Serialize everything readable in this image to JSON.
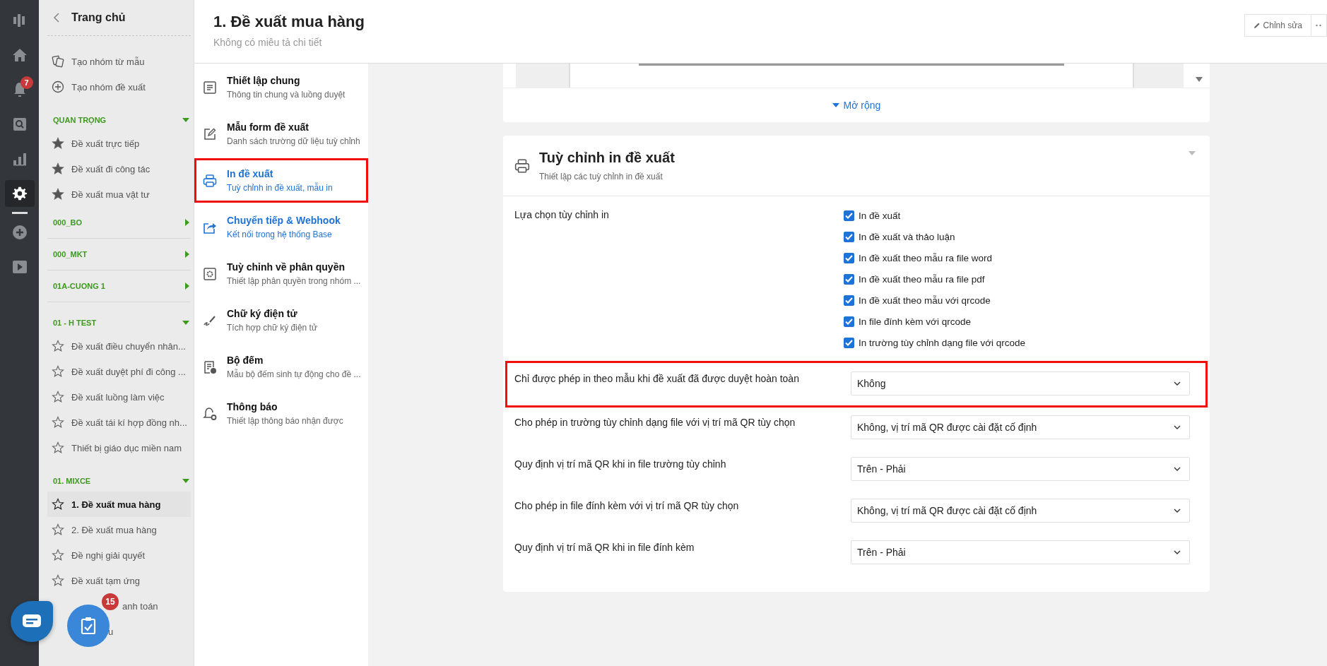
{
  "rail": [
    {
      "kind": "logo",
      "selected": false
    },
    {
      "kind": "home",
      "selected": false
    },
    {
      "kind": "bell",
      "selected": false,
      "badge": "7"
    },
    {
      "kind": "search",
      "selected": false
    },
    {
      "kind": "chart",
      "selected": false
    },
    {
      "kind": "gear",
      "selected": true
    },
    {
      "kind": "plus",
      "selected": false
    },
    {
      "kind": "play",
      "selected": false
    }
  ],
  "sidebar": {
    "title": "Trang chủ",
    "actions": [
      {
        "kind": "template",
        "label": "Tạo nhóm từ mẫu"
      },
      {
        "kind": "add",
        "label": "Tạo nhóm đề xuất"
      }
    ],
    "groups": [
      {
        "name": "QUAN TRỌNG",
        "expanded": true,
        "items": [
          {
            "label": "Đề xuất trực tiếp",
            "starred": true,
            "selected": false,
            "kind": "plain"
          },
          {
            "label": "Đề xuất đi công tác",
            "starred": true,
            "selected": false,
            "kind": "plain"
          },
          {
            "label": "Đề xuất mua vật tư",
            "starred": true,
            "selected": false,
            "kind": "plain"
          }
        ]
      },
      {
        "name": "000_BO",
        "expanded": false
      },
      {
        "name": "000_MKT",
        "expanded": false
      },
      {
        "name": "01A-CUONG 1",
        "expanded": false
      },
      {
        "name": "01 - H TEST",
        "expanded": true,
        "items": [
          {
            "label": "Đề xuất điều chuyển nhân...",
            "starred": false,
            "selected": false,
            "kind": "plain"
          },
          {
            "label": "Đề xuất duyệt phí đi công ...",
            "starred": false,
            "selected": false,
            "kind": "plain"
          },
          {
            "label": "Đề xuất luồng làm việc",
            "starred": false,
            "selected": false,
            "kind": "plain"
          },
          {
            "label": "Đề xuất tái kí hợp đồng nh...",
            "starred": false,
            "selected": false,
            "kind": "plain"
          },
          {
            "label": "Thiết bị giáo dục miền nam",
            "starred": false,
            "selected": false,
            "kind": "plain"
          }
        ]
      },
      {
        "name": "01. MIXCE",
        "expanded": true,
        "items": [
          {
            "label": "1. Đề xuất mua hàng",
            "starred": false,
            "selected": true,
            "kind": "plain"
          },
          {
            "label": "2. Đề xuất mua hàng",
            "starred": false,
            "selected": false,
            "kind": "plain"
          },
          {
            "label": "Đề nghị giải quyết",
            "starred": false,
            "selected": false,
            "kind": "plain"
          },
          {
            "label": "Đề xuất tạm ứng",
            "starred": false,
            "selected": false,
            "kind": "plain"
          },
          {
            "label": "anh toán",
            "selected": false,
            "kind": "covered"
          },
          {
            "label": "u",
            "selected": false,
            "kind": "covered"
          }
        ]
      }
    ]
  },
  "floating": {
    "tasks_badge": "15"
  },
  "header": {
    "title": "1. Đề xuất mua hàng",
    "subtitle": "Không có miêu tả chi tiết",
    "edit_button": "Chỉnh sửa"
  },
  "nav": [
    {
      "kind": "doc",
      "title": "Thiết lập chung",
      "subtitle": "Thông tin chung và luồng duyệt",
      "selected": false,
      "hovered": false,
      "highlighted": false
    },
    {
      "kind": "edit",
      "title": "Mẫu form đề xuất",
      "subtitle": "Danh sách trường dữ liệu tuỳ chỉnh",
      "selected": false,
      "hovered": false,
      "highlighted": false
    },
    {
      "kind": "print",
      "title": "In đề xuất",
      "subtitle": "Tuỳ chỉnh in đề xuất, mẫu in",
      "selected": true,
      "hovered": false,
      "highlighted": true
    },
    {
      "kind": "share",
      "title": "Chuyển tiếp & Webhook",
      "subtitle": "Kết nối trong hệ thống Base",
      "selected": false,
      "hovered": true,
      "highlighted": false
    },
    {
      "kind": "perm",
      "title": "Tuỳ chỉnh về phân quyền",
      "subtitle": "Thiết lập phân quyền trong nhóm ...",
      "selected": false,
      "hovered": false,
      "highlighted": false
    },
    {
      "kind": "sign",
      "title": "Chữ ký điện tử",
      "subtitle": "Tích hợp chữ ký điện tử",
      "selected": false,
      "hovered": false,
      "highlighted": false
    },
    {
      "kind": "counter",
      "title": "Bộ đếm",
      "subtitle": "Mẫu bộ đếm sinh tự động cho đề ...",
      "selected": false,
      "hovered": false,
      "highlighted": false
    },
    {
      "kind": "bell",
      "title": "Thông báo",
      "subtitle": "Thiết lập thông báo nhận được",
      "selected": false,
      "hovered": false,
      "highlighted": false
    }
  ],
  "preview_card": {
    "expand_link": "Mở rộng"
  },
  "print_settings": {
    "title": "Tuỳ chỉnh in đề xuất",
    "subtitle": "Thiết lập các tuỳ chỉnh in đề xuất",
    "options_label": "Lựa chọn tùy chỉnh in",
    "options": [
      {
        "label": "In đề xuất",
        "checked": true
      },
      {
        "label": "In đề xuất và thảo luận",
        "checked": true
      },
      {
        "label": "In đề xuất theo mẫu ra file word",
        "checked": true
      },
      {
        "label": "In đề xuất theo mẫu ra file pdf",
        "checked": true
      },
      {
        "label": "In đề xuất theo mẫu với qrcode",
        "checked": true
      },
      {
        "label": "In file đính kèm với qrcode",
        "checked": true
      },
      {
        "label": "In trường tùy chỉnh dạng file với qrcode",
        "checked": true
      }
    ],
    "selects": [
      {
        "label": "Chỉ được phép in theo mẫu khi đề xuất đã được duyệt hoàn toàn",
        "value": "Không",
        "highlighted": true
      },
      {
        "label": "Cho phép in trường tùy chỉnh dạng file với vị trí mã QR tùy chọn",
        "value": "Không, vị trí mã QR được cài đặt cố định",
        "highlighted": false
      },
      {
        "label": "Quy định vị trí mã QR khi in file trường tùy chỉnh",
        "value": "Trên - Phải",
        "highlighted": false
      },
      {
        "label": "Cho phép in file đính kèm với vị trí mã QR tùy chọn",
        "value": "Không, vị trí mã QR được cài đặt cố định",
        "highlighted": false
      },
      {
        "label": "Quy định vị trí mã QR khi in file đính kèm",
        "value": "Trên - Phải",
        "highlighted": false
      }
    ]
  }
}
